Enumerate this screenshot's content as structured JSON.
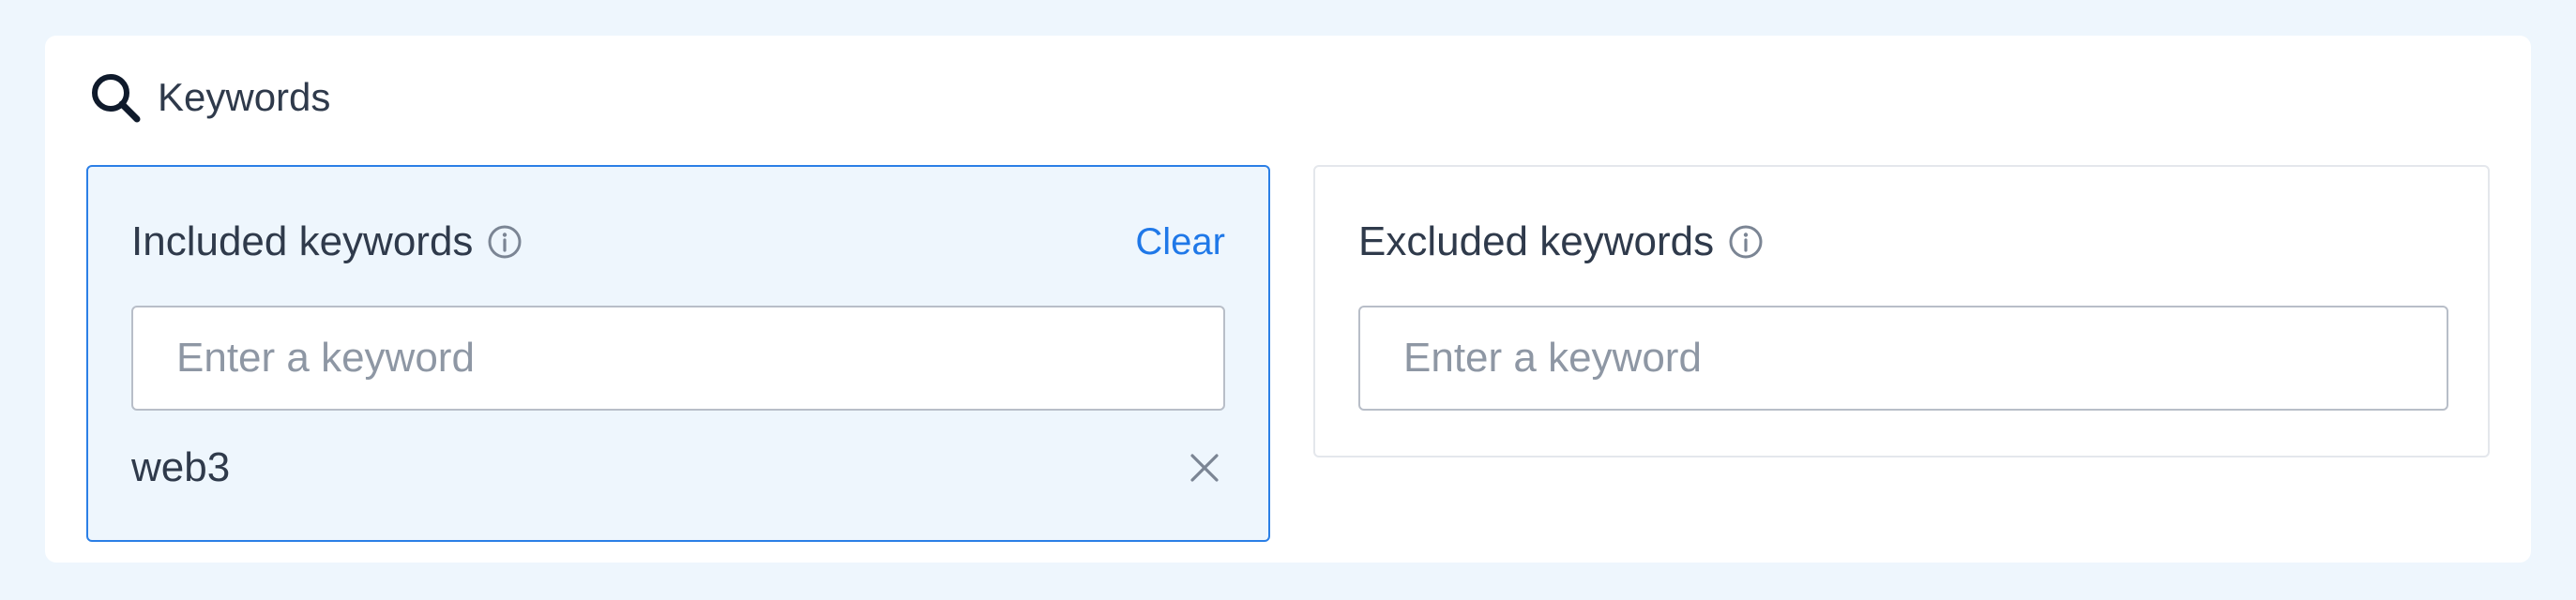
{
  "section": {
    "title": "Keywords",
    "icon": "search-icon"
  },
  "included": {
    "title": "Included keywords",
    "info_icon": "info-icon",
    "clear_label": "Clear",
    "input_placeholder": "Enter a keyword",
    "input_value": "",
    "tags": [
      {
        "text": "web3",
        "remove_icon": "close-icon"
      }
    ]
  },
  "excluded": {
    "title": "Excluded keywords",
    "info_icon": "info-icon",
    "input_placeholder": "Enter a keyword",
    "input_value": ""
  },
  "colors": {
    "accent": "#1f78e8",
    "active_border": "#2b7fe6",
    "active_bg": "#eef6fd",
    "text": "#2f3a4b",
    "placeholder": "#8e97a4"
  }
}
